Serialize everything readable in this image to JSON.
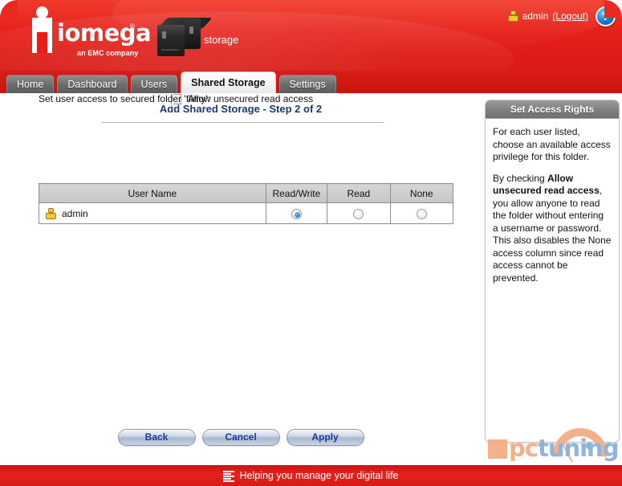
{
  "header": {
    "brand_name": "iomega",
    "brand_tagline": "an EMC company",
    "device_label": "storage",
    "user_name": "admin",
    "logout_label": "(Logout)",
    "help_glyph": "?",
    "brand_red": "#e5201b"
  },
  "tabs": [
    {
      "label": "Home",
      "active": false
    },
    {
      "label": "Dashboard",
      "active": false
    },
    {
      "label": "Users",
      "active": false
    },
    {
      "label": "Shared Storage",
      "active": true
    },
    {
      "label": "Settings",
      "active": false
    }
  ],
  "main": {
    "page_title": "Add Shared Storage - Step 2 of 2",
    "unsecured_checkbox_label": "Allow unsecured read access",
    "unsecured_checkbox_checked": false,
    "access_instruction": "Set user access to secured folder 'filmy':",
    "table": {
      "headers": [
        "User Name",
        "Read/Write",
        "Read",
        "None"
      ],
      "rows": [
        {
          "user": "admin",
          "read_write": true,
          "read": false,
          "none": false
        }
      ]
    },
    "buttons": [
      {
        "label": "Back"
      },
      {
        "label": "Cancel"
      },
      {
        "label": "Apply"
      }
    ]
  },
  "sidebar": {
    "title": "Set Access Rights",
    "paragraph_1": "For each user listed, choose an available access privilege for this folder.",
    "paragraph_2_lead": "By checking ",
    "paragraph_2_bold": "Allow unsecured read access",
    "paragraph_2_tail": ", you allow anyone to read the folder without entering a username or password. This also disables the None access column since read access cannot be prevented."
  },
  "watermark": {
    "text_pc": "pc",
    "text_tuning": "tuning"
  },
  "footer": {
    "tagline": "Helping you manage your digital life"
  }
}
